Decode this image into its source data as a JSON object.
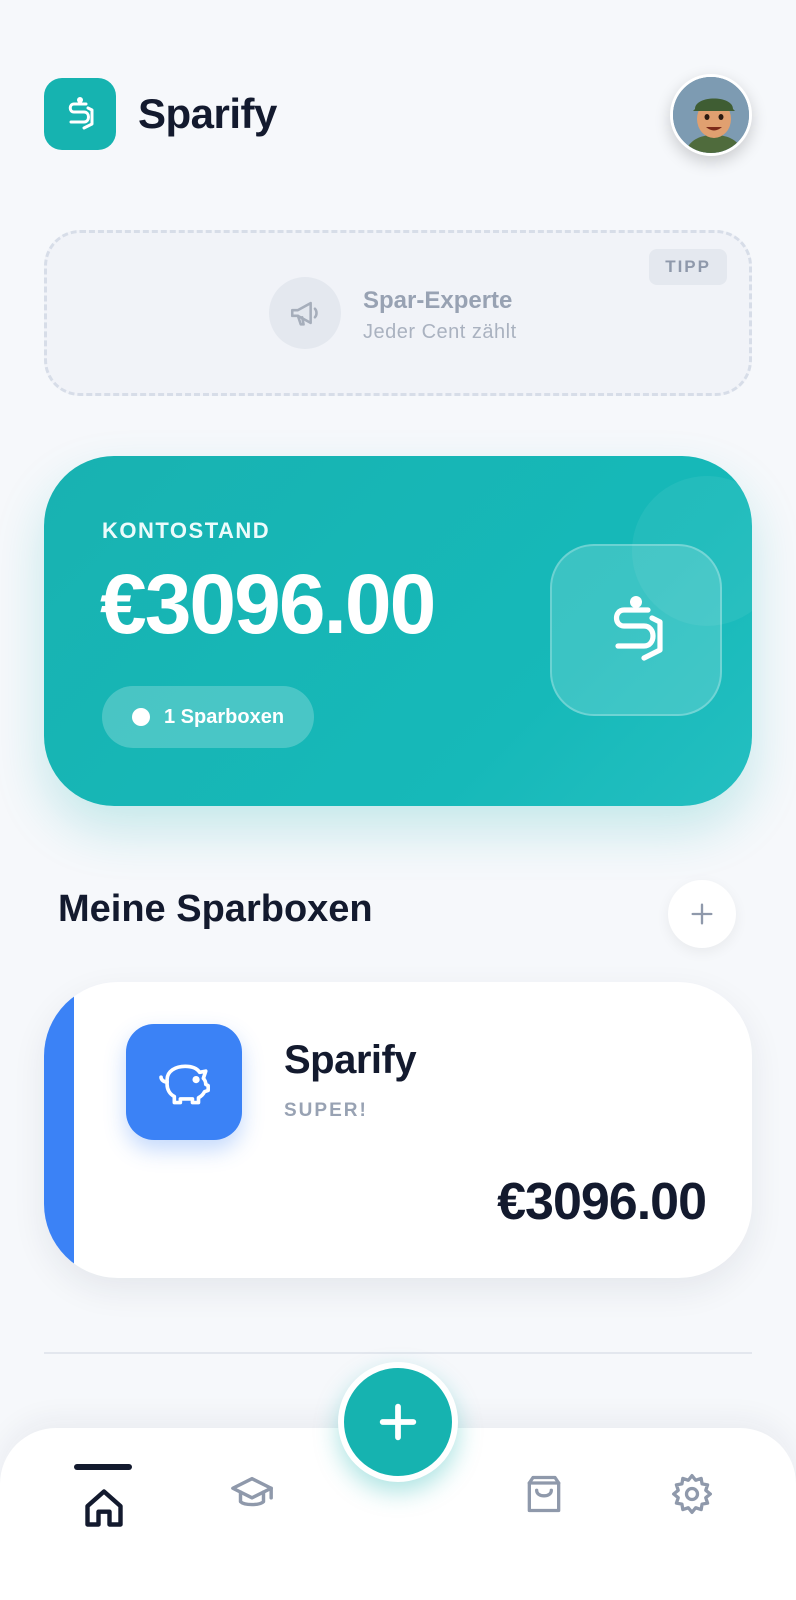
{
  "app": {
    "title": "Sparify"
  },
  "tip": {
    "badge": "TIPP",
    "title": "Spar-Experte",
    "subtitle": "Jeder Cent zählt",
    "icon": "megaphone-icon"
  },
  "balance": {
    "label": "KONTOSTAND",
    "amount": "€3096.00",
    "box_count": "1 Sparboxen"
  },
  "boxes_section": {
    "title": "Meine Sparboxen"
  },
  "boxes": [
    {
      "name": "Sparify",
      "status": "SUPER!",
      "amount": "€3096.00",
      "icon": "piggy-bank-icon",
      "color": "#3b82f6"
    }
  ],
  "colors": {
    "accent": "#16b3b0",
    "dark": "#131a2e",
    "box_blue": "#3b82f6"
  },
  "nav": {
    "items": [
      {
        "name": "home",
        "icon": "home-icon",
        "active": true
      },
      {
        "name": "learn",
        "icon": "graduation-cap-icon",
        "active": false
      },
      {
        "name": "shop",
        "icon": "shopping-bag-icon",
        "active": false
      },
      {
        "name": "settings",
        "icon": "gear-icon",
        "active": false
      }
    ],
    "fab_icon": "plus-icon"
  }
}
